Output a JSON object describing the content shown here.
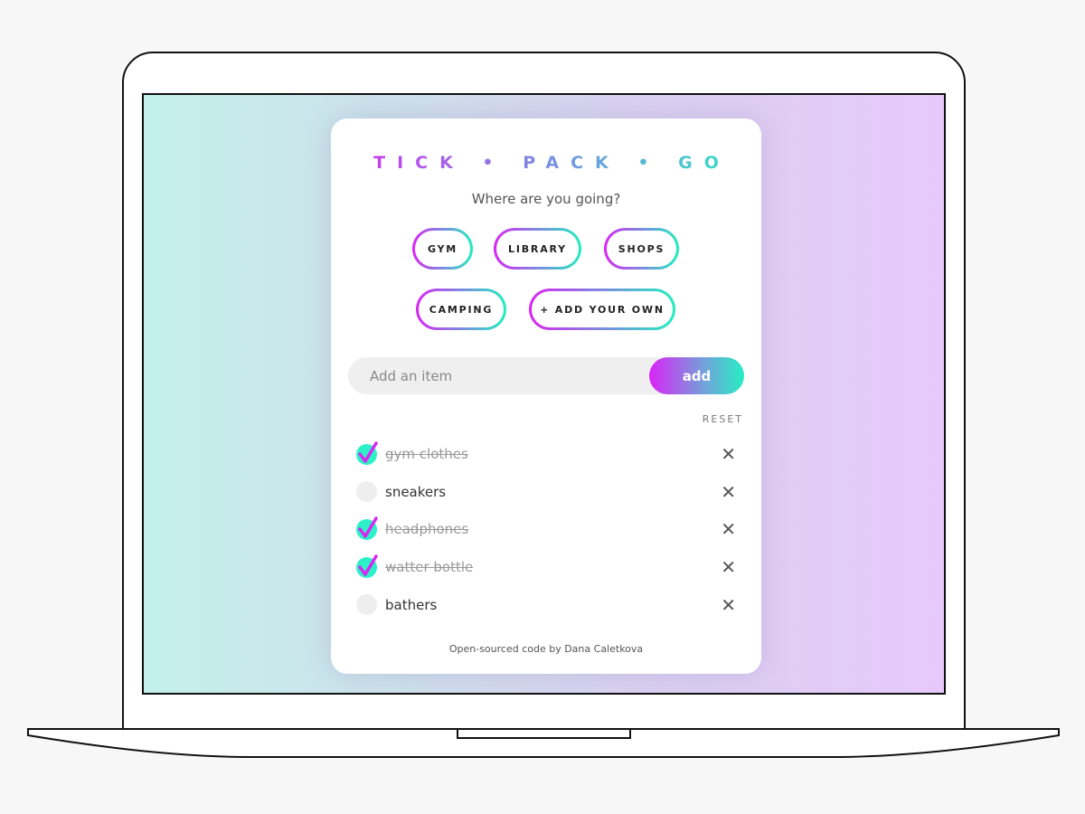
{
  "app": {
    "title": "TICK • PACK • GO",
    "subtitle": "Where are you going?"
  },
  "destinations": [
    {
      "label": "GYM"
    },
    {
      "label": "LIBRARY"
    },
    {
      "label": "SHOPS"
    },
    {
      "label": "CAMPING"
    },
    {
      "label": "+ ADD YOUR OWN"
    }
  ],
  "input": {
    "placeholder": "Add an item",
    "value": "",
    "add_label": "add"
  },
  "reset_label": "RESET",
  "items": [
    {
      "label": "gym clothes",
      "checked": true
    },
    {
      "label": "sneakers",
      "checked": false
    },
    {
      "label": "headphones",
      "checked": true
    },
    {
      "label": "watter bottle",
      "checked": true
    },
    {
      "label": "bathers",
      "checked": false
    }
  ],
  "remove_icon": "close-icon",
  "footer": "Open-sourced code by Dana Caletkova",
  "colors": {
    "accent_pink": "#d926f3",
    "accent_teal": "#23eec0"
  }
}
